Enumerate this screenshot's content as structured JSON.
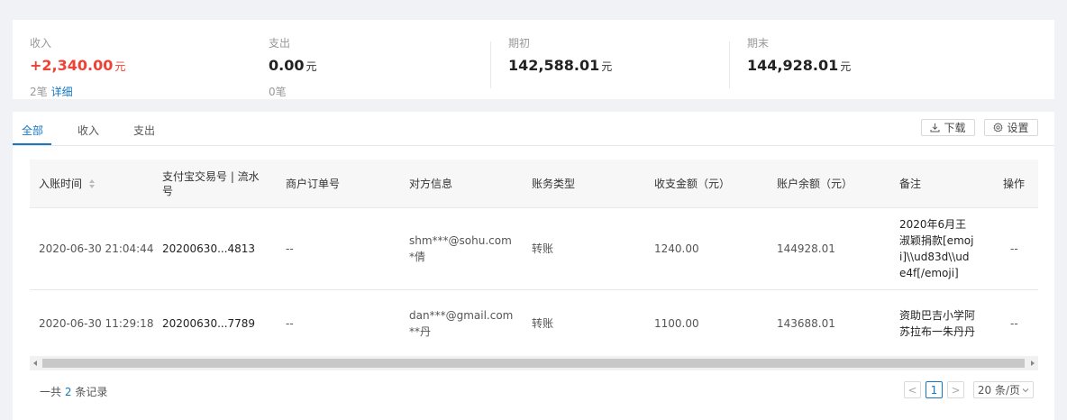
{
  "summary": {
    "income": {
      "label": "收入",
      "amount": "+2,340.00",
      "unit": "元",
      "count": "2笔",
      "detail_link": "详细"
    },
    "expense": {
      "label": "支出",
      "amount": "0.00",
      "unit": "元",
      "count": "0笔"
    },
    "opening": {
      "label": "期初",
      "amount": "142,588.01",
      "unit": "元"
    },
    "closing": {
      "label": "期末",
      "amount": "144,928.01",
      "unit": "元"
    },
    "colors": {
      "income": "#f04134",
      "link": "#1677c4"
    }
  },
  "tabs": [
    {
      "label": "全部",
      "active": true
    },
    {
      "label": "收入",
      "active": false
    },
    {
      "label": "支出",
      "active": false
    }
  ],
  "toolbar": {
    "download_label": "下载",
    "download_icon": "download-icon",
    "settings_label": "设置",
    "settings_icon": "gear-icon"
  },
  "table": {
    "columns": [
      "入账时间",
      "支付宝交易号 | 流水号",
      "商户订单号",
      "对方信息",
      "账务类型",
      "收支金额（元）",
      "账户余额（元）",
      "备注",
      "操作"
    ],
    "rows": [
      {
        "time": "2020-06-30 21:04:44",
        "trade_no": "20200630...4813",
        "order_no": "--",
        "party_line1": "shm***@sohu.com",
        "party_line2": "*倩",
        "type": "转账",
        "amount": "1240.00",
        "balance": "144928.01",
        "remark": "2020年6月王淑颖捐款[emoji]\\\\ud83d\\\\ude4f[/emoji]",
        "action": "--"
      },
      {
        "time": "2020-06-30 11:29:18",
        "trade_no": "20200630...7789",
        "order_no": "--",
        "party_line1": "dan***@gmail.com",
        "party_line2": "**丹",
        "type": "转账",
        "amount": "1100.00",
        "balance": "143688.01",
        "remark": "资助巴吉小学阿苏拉布一朱丹丹",
        "action": "--"
      }
    ]
  },
  "pagination": {
    "total_prefix": "一共",
    "total_count": "2",
    "total_suffix": "条记录",
    "current_page": "1",
    "prev": "<",
    "next": ">",
    "page_size": "20 条/页"
  }
}
